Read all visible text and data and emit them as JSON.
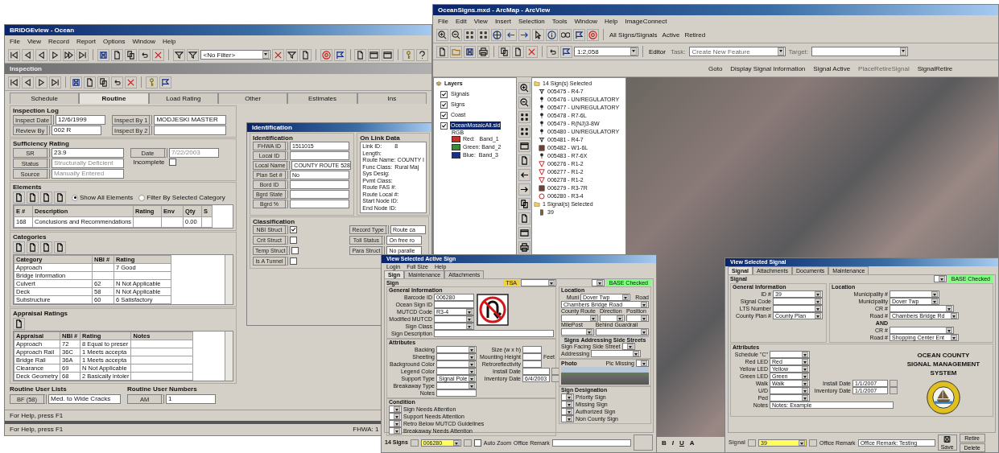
{
  "bridgeview": {
    "title": "BRIDGEview - Ocean",
    "menu": [
      "File",
      "View",
      "Record",
      "Report",
      "Options",
      "Window",
      "Help"
    ],
    "filter": "<No Filter>",
    "inspection": {
      "title": "Inspection",
      "tabs": [
        {
          "label": "Schedule",
          "selected": false
        },
        {
          "label": "Routine",
          "selected": true
        },
        {
          "label": "Load Rating",
          "selected": false
        },
        {
          "label": "Other",
          "selected": false
        },
        {
          "label": "Estimates",
          "selected": false
        },
        {
          "label": "Ins",
          "selected": false
        }
      ],
      "log": {
        "title": "Inspection Log",
        "left": [
          {
            "label": "Inspect Date",
            "value": "12/6/1999"
          },
          {
            "label": "Review By",
            "value": "002  R"
          }
        ],
        "right": [
          {
            "label": "Inspect By 1",
            "value": "MODJESKI MASTER"
          },
          {
            "label": "Inspect By 2"
          }
        ]
      },
      "sufficiency": {
        "title": "Sufficiency Rating",
        "fields": [
          {
            "label": "SR",
            "value": "23.9",
            "disabled": false
          },
          {
            "label": "Status",
            "value": "Structurally Deficient",
            "disabled": true
          },
          {
            "label": "Source",
            "value": "Manually Entered",
            "disabled": true
          }
        ],
        "date": {
          "label": "Date",
          "value": "7/22/2003",
          "disabled": true
        },
        "incomplete": {
          "label": "Incomplete",
          "checked": false
        }
      },
      "elements": {
        "title": "Elements",
        "filters": [
          {
            "label": "Show All Elements",
            "selected": true
          },
          {
            "label": "Filter By Selected Category",
            "selected": false
          }
        ],
        "columns": [
          "E #",
          "Description",
          "Rating",
          "Env",
          "Qty",
          "S"
        ],
        "rows": [
          [
            "168",
            "Conclusions and Recommendations",
            null,
            null,
            "0.00",
            null
          ]
        ]
      },
      "categories": {
        "title": "Categories",
        "columns": [
          "Category",
          "NBI #",
          "Rating"
        ],
        "rows": [
          [
            "Approach",
            null,
            "7 Good"
          ],
          [
            "Bridge Information",
            null,
            null
          ],
          [
            "Culvert",
            "62",
            "N Not Applicable"
          ],
          [
            "Deck",
            "58",
            "N Not Applicable"
          ],
          [
            "Substructure",
            "60",
            "6 Satisfactory"
          ]
        ]
      },
      "appraisal": {
        "title": "Appraisal Ratings",
        "columns": [
          "Appraisal",
          "NBI #",
          "Rating",
          "Notes"
        ],
        "rows": [
          [
            "Approach",
            "72",
            "8 Equal to preser",
            null
          ],
          [
            "Approach Rail",
            "36C",
            "1 Meets accepta",
            null
          ],
          [
            "Bridge Rail",
            "36A",
            "1 Meets accepta",
            null
          ],
          [
            "Clearance",
            "69",
            "N Not Applicable",
            null
          ],
          [
            "Deck Geometry",
            "68",
            "2 Basically intoler",
            null
          ]
        ]
      },
      "user_lists": {
        "title": "Routine User Lists",
        "button": "BF (58)",
        "value": "Med. to Wide Cracks"
      },
      "user_numbers": {
        "title": "Routine User Numbers",
        "button": "AM",
        "value": "1"
      },
      "status": "For Help, press F1"
    },
    "status_bar": [
      "For Help, press F1",
      "FHWA: 1"
    ]
  },
  "identification": {
    "title": "Identification",
    "section": "Identification",
    "fields": [
      {
        "label": "FHWA ID",
        "value": "1511015"
      },
      {
        "label": "Local ID"
      },
      {
        "label": "Local Name",
        "value": "COUNTY ROUTE 528"
      },
      {
        "label": "Plan Set #",
        "value": "No"
      },
      {
        "label": "Bord ID"
      },
      {
        "label": "Bgrd State"
      },
      {
        "label": "Bgrd %"
      }
    ],
    "link_title": "On Link Data",
    "link_data": [
      {
        "label": "Link ID:",
        "value": "8"
      },
      {
        "label": "Length:"
      },
      {
        "label": "Route Name:",
        "value": "COUNTY I"
      },
      {
        "label": "Func Class:",
        "value": "Rural Maj"
      },
      {
        "label": "Sys Desig:"
      },
      {
        "label": "Pvmt Class:"
      },
      {
        "label": "Route FAS #:"
      },
      {
        "label": "Route Local #:"
      },
      {
        "label": "Start Node ID:"
      },
      {
        "label": "End Node ID:"
      }
    ],
    "classification_title": "Classification",
    "checks": [
      {
        "label": "NBI Struct",
        "checked": true
      },
      {
        "label": "Crit Struct",
        "checked": false
      },
      {
        "label": "Temp Struct",
        "checked": false
      },
      {
        "label": "Is A Tunnel",
        "checked": false
      }
    ],
    "class_fields": [
      {
        "label": "Record Type",
        "value": "Route ca"
      },
      {
        "label": "Toll Status",
        "value": "On free ro"
      },
      {
        "label": "Para Struct",
        "value": "No paralle"
      }
    ]
  },
  "arcmap": {
    "title": "OceanSigns.mxd - ArcMap - ArcView",
    "menu": [
      "File",
      "Edit",
      "View",
      "Insert",
      "Selection",
      "Tools",
      "Window",
      "Help",
      "ImageConnect"
    ],
    "toolbar_links": [
      "All Signs/Signals",
      "Active",
      "Retired"
    ],
    "scale": "1:2,058",
    "editor": "Editor",
    "task_label": "Task:",
    "task": "Create New Feature",
    "target_label": "Target:",
    "commands": [
      {
        "label": "Goto",
        "disabled": false
      },
      {
        "label": "Display Signal Information",
        "disabled": false
      },
      {
        "label": "Signal Active",
        "disabled": false
      },
      {
        "label": "PlaceRetireSignal",
        "disabled": true
      },
      {
        "label": "SignalRetire",
        "disabled": false
      }
    ],
    "layers": {
      "title": "Layers",
      "children": [
        {
          "label": "Signals",
          "checked": true,
          "selected": false
        },
        {
          "label": "Signs",
          "checked": true,
          "selected": false
        },
        {
          "label": "Coast",
          "checked": true,
          "selected": false
        },
        {
          "label": "OceanMosaicAll.sid",
          "checked": true,
          "selected": true,
          "band_title": "RGB",
          "bands": [
            {
              "label": "Red:   Band_1",
              "color": "#c8302c"
            },
            {
              "label": "Green: Band_2",
              "color": "#3c8a3c"
            },
            {
              "label": "Blue:  Band_3",
              "color": "#1a2f8a"
            }
          ]
        }
      ]
    },
    "selection": [
      {
        "label": "14 Sign(s) Selected",
        "items": [
          {
            "label": "005475 - R4-7",
            "kind": "keep"
          },
          {
            "label": "005476 - UN/REGULATORY",
            "kind": "pin"
          },
          {
            "label": "005477 - UN/REGULATORY",
            "kind": "pin"
          },
          {
            "label": "005478 - R7-6L",
            "kind": "pin"
          },
          {
            "label": "005479 - R(NJ)3-8W",
            "kind": "pin"
          },
          {
            "label": "005480 - UN/REGULATORY",
            "kind": "pin"
          },
          {
            "label": "005481 - R4-7",
            "kind": "keep"
          },
          {
            "label": "005482 - W1-6L",
            "kind": "square"
          },
          {
            "label": "005483 - R7-6X",
            "kind": "pin"
          },
          {
            "label": "006276 - R1-2",
            "kind": "yield"
          },
          {
            "label": "006277 - R1-2",
            "kind": "yield"
          },
          {
            "label": "006278 - R1-2",
            "kind": "yield"
          },
          {
            "label": "006279 - R3-7R",
            "kind": "square"
          },
          {
            "label": "006280 - R3-4",
            "kind": "circle"
          }
        ]
      },
      {
        "label": "1 Signal(s) Selected",
        "items": [
          {
            "label": "39",
            "kind": "signal"
          }
        ]
      }
    ],
    "draw_toolbar": [
      "B",
      "I",
      "U",
      "A"
    ]
  },
  "sign_window": {
    "title": "View Selected Active Sign",
    "menu": [
      "Login",
      "Full Size",
      "Help"
    ],
    "tabs": [
      {
        "label": "Sign",
        "selected": true
      },
      {
        "label": "Maintenance",
        "selected": false
      },
      {
        "label": "Attachments",
        "selected": false
      }
    ],
    "group": "Sign",
    "tsa": "TSA",
    "base_status": "BASE Checked",
    "general": {
      "title": "General Information",
      "fields": [
        {
          "label": "Barcode ID",
          "value": "006280",
          "kind": "text"
        },
        {
          "label": "Ocean Sign ID",
          "kind": "text"
        },
        {
          "label": "MUTCD Code",
          "value": "R3-4",
          "kind": "select"
        },
        {
          "label": "Modified MUTCD",
          "kind": "select"
        },
        {
          "label": "Sign Class",
          "kind": "select"
        },
        {
          "label": "Sign Description",
          "kind": "text"
        }
      ]
    },
    "location": {
      "title": "Location",
      "muni_label": "Muni",
      "muni": "Dover Twp",
      "road_label": "Road",
      "road": "Chambers Bridge Road",
      "headers": [
        "County Route",
        "Direction",
        "Position",
        "MilePost",
        "Behind Guardrail"
      ],
      "side_title": "Signs Addressing Side Streets",
      "facing": "Sign Facing Side Street",
      "addressing": "Addressing"
    },
    "pic_missing": "Pic Missing",
    "photo_title": "Photo",
    "attributes": {
      "title": "Attributes",
      "fields": [
        {
          "label": "Backing",
          "kind": "select"
        },
        {
          "label": "Sheeting",
          "kind": "select"
        },
        {
          "label": "Background Color",
          "kind": "select"
        },
        {
          "label": "Legend Color",
          "kind": "select"
        },
        {
          "label": "Support Type",
          "value": "Signal Pole",
          "kind": "select"
        },
        {
          "label": "Breakaway Type",
          "kind": "select"
        },
        {
          "label": "Notes",
          "kind": "text"
        }
      ],
      "side": [
        {
          "label": "Size (w x h)",
          "kind": "text"
        },
        {
          "label": "Mounting Height",
          "kind": "text",
          "unit": "Feet"
        },
        {
          "label": "Retroreflectivity",
          "kind": "text"
        },
        {
          "label": "Install Date",
          "kind": "date"
        },
        {
          "label": "Inventory Date",
          "value": "6/4/2003",
          "kind": "date"
        }
      ]
    },
    "condition": {
      "title": "Condition",
      "items": [
        "Sign Needs Attention",
        "Support Needs Attention",
        "Retro Below MUTCD Guidelines",
        "Breakaway Needs Attention"
      ]
    },
    "designation": {
      "title": "Sign Designation",
      "items": [
        "Priority Sign",
        "Missing Sign",
        "Authorized Sign",
        "Non County Sign"
      ]
    },
    "footer": {
      "title": "14 Signs",
      "current": "006280",
      "auto_zoom": {
        "label": "Auto Zoom",
        "checked": false
      },
      "remark_label": "Office Remark"
    }
  },
  "signal_window": {
    "title": "View Selected Signal",
    "tabs": [
      {
        "label": "Signal",
        "selected": true
      },
      {
        "label": "Attachments",
        "selected": false
      },
      {
        "label": "Documents",
        "selected": false
      },
      {
        "label": "Maintenance",
        "selected": false
      }
    ],
    "group": "Signal",
    "base_status": "BASE Checked",
    "general": {
      "title": "General Information",
      "fields": [
        {
          "label": "ID #",
          "value": "39"
        },
        {
          "label": "Signal Code"
        },
        {
          "label": "LTS Number"
        },
        {
          "label": "County Plan #",
          "value": "County Plan"
        }
      ]
    },
    "location": {
      "title": "Location",
      "fields": [
        {
          "label": "Municipality #"
        },
        {
          "label": "Municipality",
          "value": "Dover Twp"
        }
      ],
      "join": "AND",
      "roads": [
        {
          "cr_label": "CR #",
          "road_label": "Road #",
          "road": "Chambers Bridge Rd"
        },
        {
          "cr_label": "CR #",
          "road_label": "Road #",
          "road": "Shopping Center Ent"
        }
      ]
    },
    "attributes": {
      "title": "Attributes",
      "fields": [
        {
          "label": "Schedule \"C\""
        },
        {
          "label": "Red LED",
          "value": "Red"
        },
        {
          "label": "Yellow LED",
          "value": "Yellow"
        },
        {
          "label": "Green LED",
          "value": "Green"
        },
        {
          "label": "Walk",
          "value": "Walk"
        },
        {
          "label": "U/D"
        },
        {
          "label": "Ped"
        }
      ],
      "dates": [
        {
          "label": "Install Date",
          "value": "1/1/2007"
        },
        {
          "label": "Inventory Date",
          "value": "1/1/2007"
        }
      ],
      "notes_label": "Notes",
      "notes": "Notes: Example"
    },
    "logo_lines": [
      "OCEAN COUNTY",
      "SIGNAL MANAGEMENT",
      "SYSTEM"
    ],
    "footer": {
      "title": "Signal",
      "current": "39",
      "remark_label": "Office Remark",
      "remark": "Office Remark: Testing",
      "buttons": [
        "Save",
        "Retire",
        "Delete"
      ]
    }
  }
}
